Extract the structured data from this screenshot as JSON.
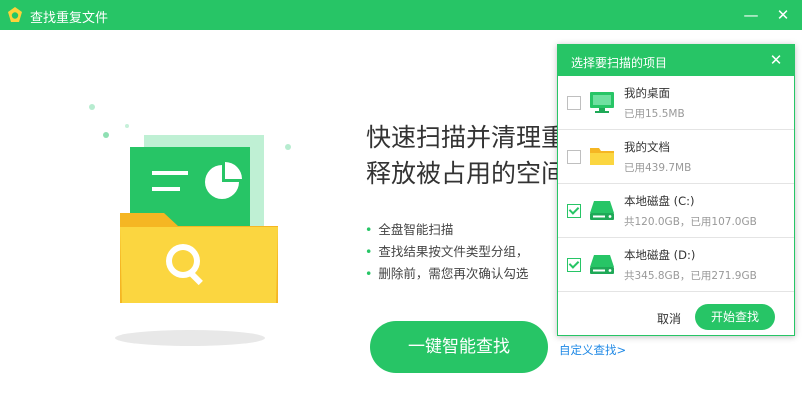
{
  "window": {
    "title": "查找重复文件",
    "minimize_icon": "minimize-icon",
    "close_icon": "close-icon"
  },
  "main": {
    "headline_line1": "快速扫描并清理重",
    "headline_line2": "释放被占用的空间",
    "features": [
      "全盘智能扫描",
      "查找结果按文件类型分组，",
      "删除前，需您再次确认勾选"
    ],
    "smart_search_button": "一键智能查找",
    "custom_search_link": "自定义查找>"
  },
  "dialog": {
    "title": "选择要扫描的项目",
    "items": [
      {
        "name": "我的桌面",
        "detail": "已用15.5MB",
        "checked": false,
        "icon": "desktop-icon"
      },
      {
        "name": "我的文档",
        "detail": "已用439.7MB",
        "checked": false,
        "icon": "folder-icon"
      },
      {
        "name": "本地磁盘 (C:)",
        "detail": "共120.0GB，已用107.0GB",
        "checked": true,
        "icon": "drive-icon"
      },
      {
        "name": "本地磁盘 (D:)",
        "detail": "共345.8GB，已用271.9GB",
        "checked": true,
        "icon": "drive-icon"
      }
    ],
    "cancel_label": "取消",
    "start_label": "开始查找"
  },
  "colors": {
    "accent": "#27c566",
    "link": "#1e88e5",
    "folder": "#f7c531"
  }
}
